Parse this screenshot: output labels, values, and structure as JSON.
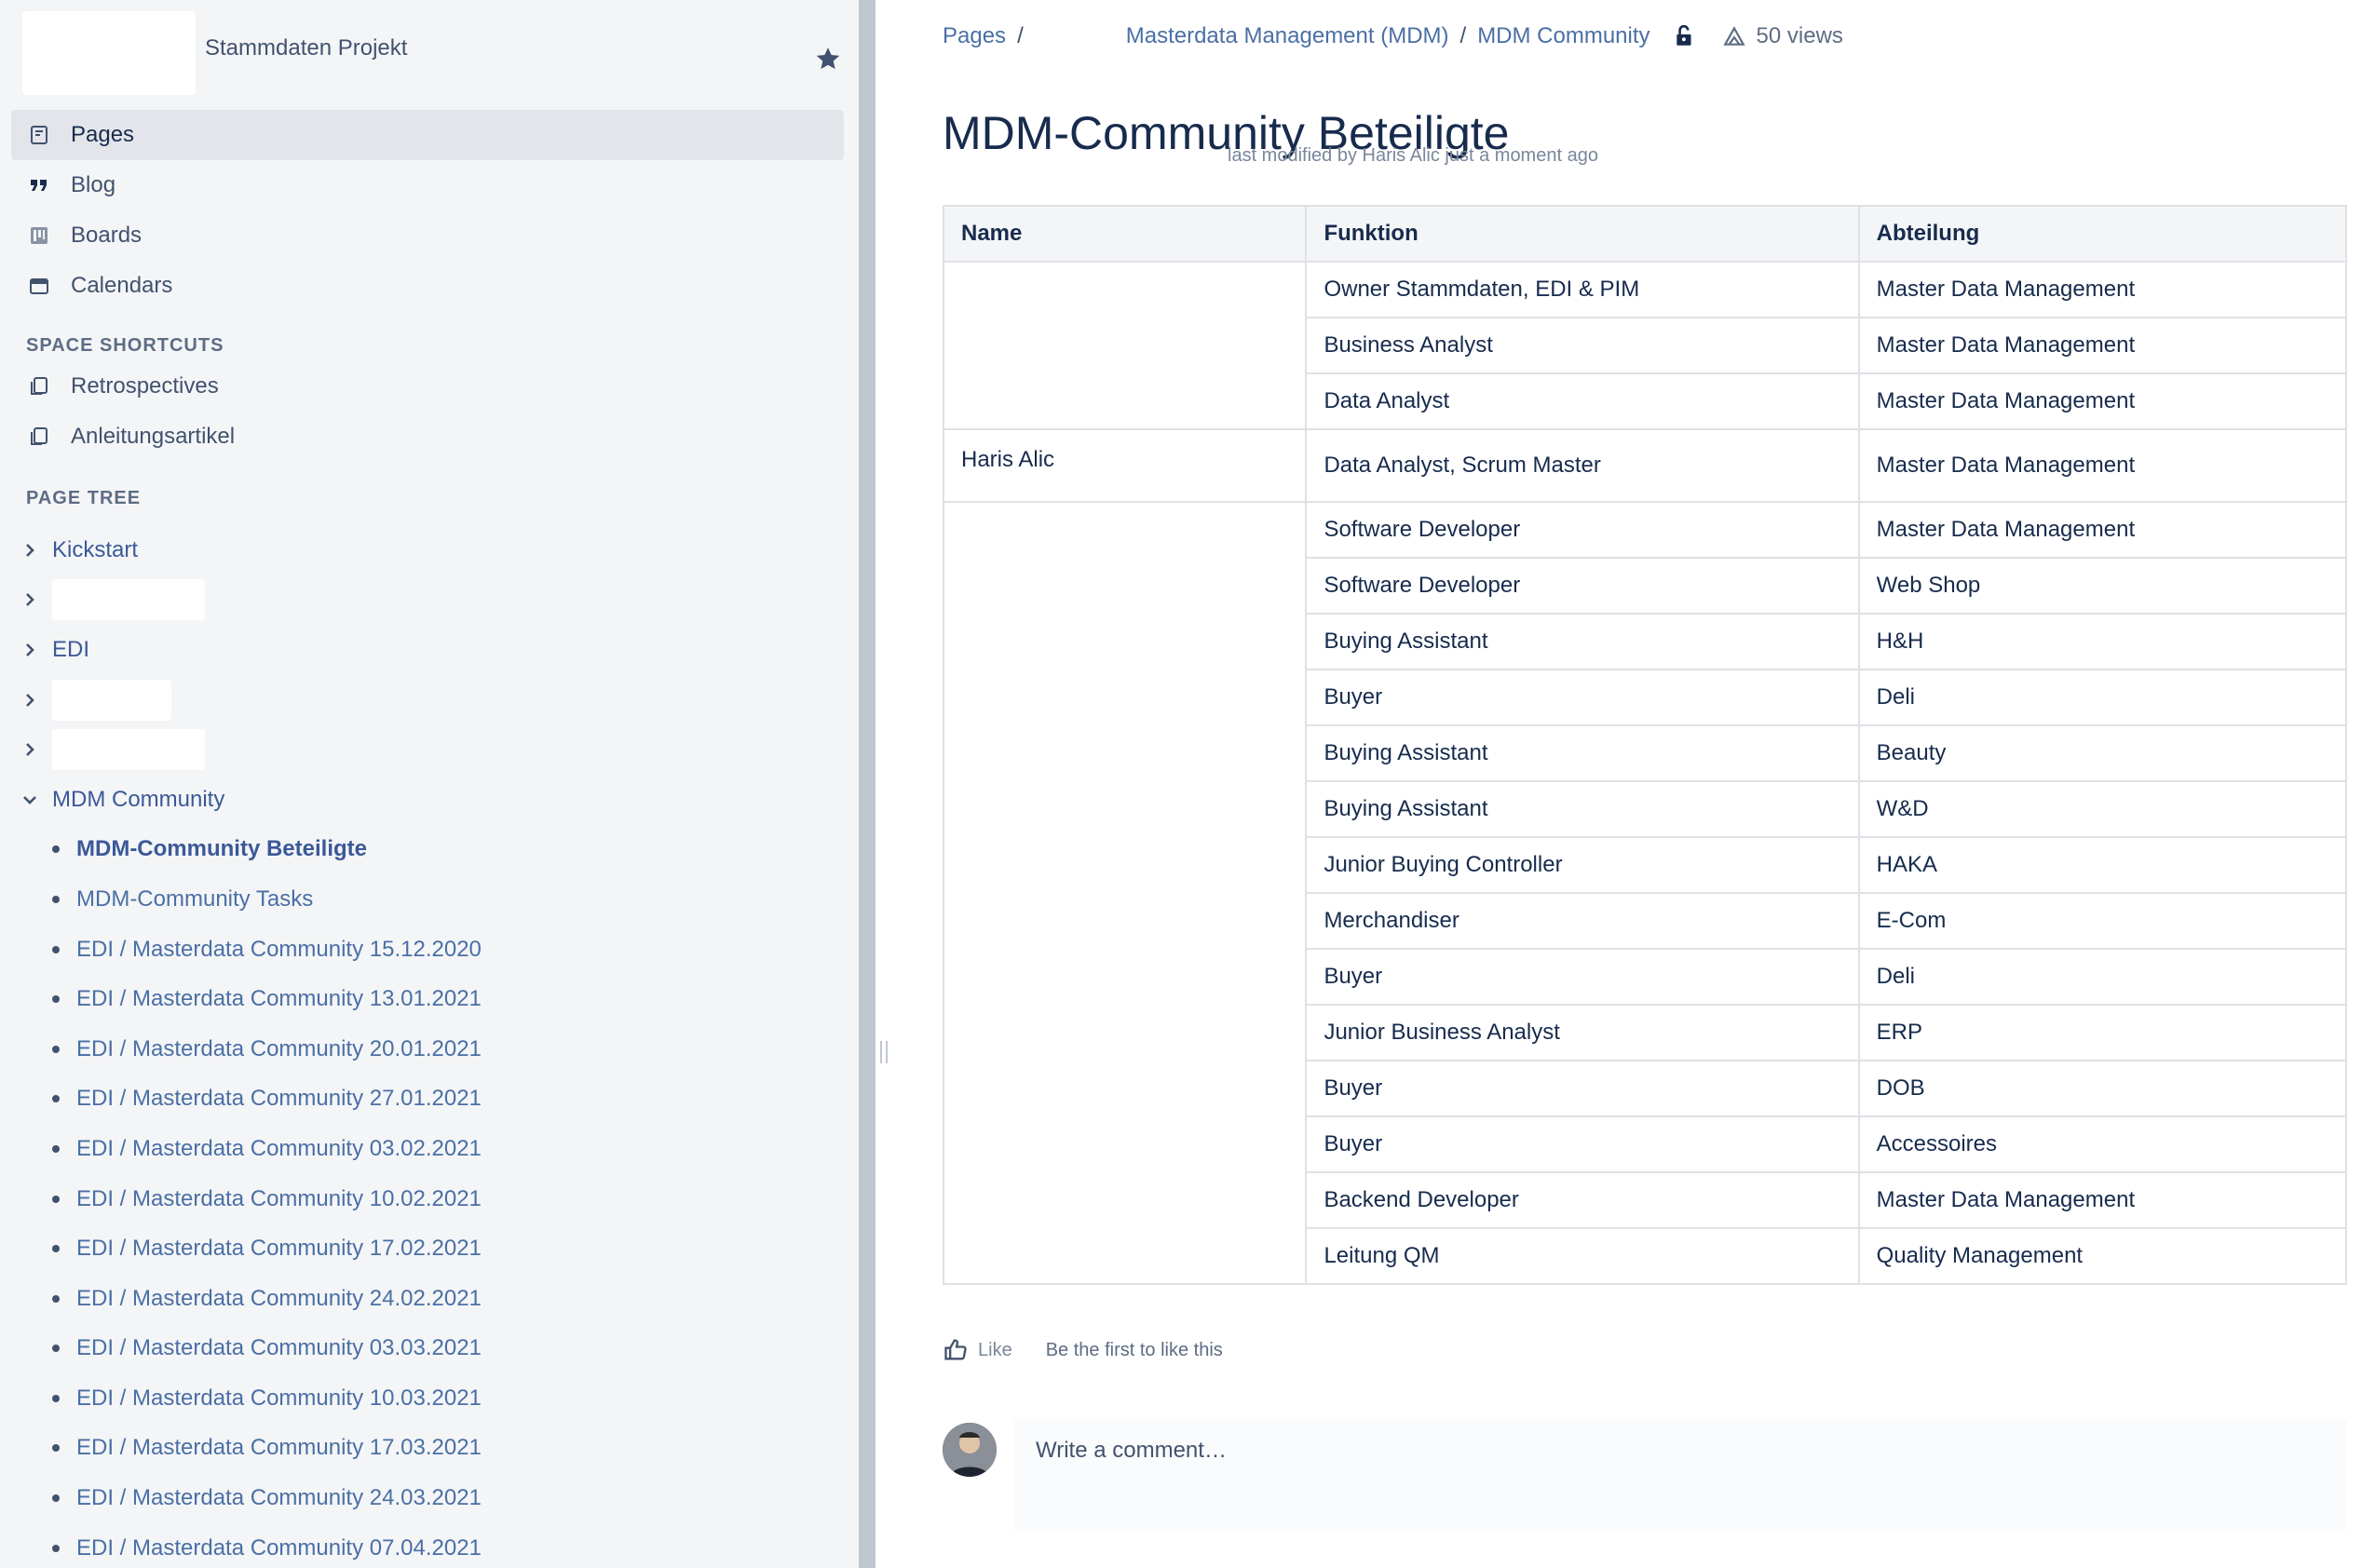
{
  "sidebar": {
    "space_title": "Stammdaten Projekt",
    "nav": [
      {
        "label": "Pages",
        "icon": "page-icon"
      },
      {
        "label": "Blog",
        "icon": "quote-icon"
      },
      {
        "label": "Boards",
        "icon": "board-icon"
      },
      {
        "label": "Calendars",
        "icon": "calendar-icon"
      }
    ],
    "shortcuts_heading": "SPACE SHORTCUTS",
    "shortcuts": [
      {
        "label": "Retrospectives",
        "icon": "copy-icon"
      },
      {
        "label": "Anleitungsartikel",
        "icon": "copy-icon"
      }
    ],
    "tree_heading": "PAGE TREE",
    "tree": [
      {
        "label": "Kickstart"
      },
      {
        "label": ""
      },
      {
        "label": "EDI"
      },
      {
        "label": ""
      },
      {
        "label": ""
      }
    ],
    "expanded_node": "MDM Community",
    "children": [
      "MDM-Community Beteiligte",
      "MDM-Community Tasks",
      "EDI / Masterdata Community 15.12.2020",
      "EDI / Masterdata Community 13.01.2021",
      "EDI / Masterdata Community 20.01.2021",
      "EDI / Masterdata Community 27.01.2021",
      "EDI / Masterdata Community 03.02.2021",
      "EDI / Masterdata Community 10.02.2021",
      "EDI / Masterdata Community 17.02.2021",
      "EDI / Masterdata Community 24.02.2021",
      "EDI / Masterdata Community 03.03.2021",
      "EDI / Masterdata Community 10.03.2021",
      "EDI / Masterdata Community 17.03.2021",
      "EDI / Masterdata Community 24.03.2021",
      "EDI / Masterdata Community 07.04.2021"
    ]
  },
  "breadcrumb": {
    "pages": "Pages",
    "crumb2": "Masterdata Management (MDM)",
    "crumb3": "MDM Community",
    "sep": "/",
    "views": "50 views"
  },
  "page": {
    "title": "MDM-Community Beteiligte",
    "byline": "last modified by Haris Alic just a moment ago"
  },
  "table": {
    "headers": [
      "Name",
      "Funktion",
      "Abteilung"
    ],
    "name_groups": [
      {
        "name": "",
        "rows": 3
      },
      {
        "name": "Haris Alic",
        "rows": 1
      },
      {
        "name": "",
        "rows": 14
      }
    ],
    "rows": [
      {
        "funktion": "Owner Stammdaten, EDI & PIM",
        "abteilung": "Master Data Management"
      },
      {
        "funktion": "Business Analyst",
        "abteilung": "Master Data Management"
      },
      {
        "funktion": "Data Analyst",
        "abteilung": "Master Data Management"
      },
      {
        "funktion": "Data Analyst, Scrum Master",
        "abteilung": "Master Data Management"
      },
      {
        "funktion": "Software Developer",
        "abteilung": "Master Data Management"
      },
      {
        "funktion": "Software Developer",
        "abteilung": "Web Shop"
      },
      {
        "funktion": "Buying Assistant",
        "abteilung": "H&H"
      },
      {
        "funktion": "Buyer",
        "abteilung": "Deli"
      },
      {
        "funktion": "Buying Assistant",
        "abteilung": "Beauty"
      },
      {
        "funktion": "Buying Assistant",
        "abteilung": "W&D"
      },
      {
        "funktion": "Junior Buying Controller",
        "abteilung": "HAKA"
      },
      {
        "funktion": "Merchandiser",
        "abteilung": "E-Com"
      },
      {
        "funktion": "Buyer",
        "abteilung": "Deli"
      },
      {
        "funktion": "Junior Business Analyst",
        "abteilung": "ERP"
      },
      {
        "funktion": "Buyer",
        "abteilung": "DOB"
      },
      {
        "funktion": "Buyer",
        "abteilung": "Accessoires"
      },
      {
        "funktion": "Backend Developer",
        "abteilung": "Master Data Management"
      },
      {
        "funktion": "Leitung QM",
        "abteilung": "Quality Management"
      }
    ]
  },
  "footer": {
    "like_label": "Like",
    "like_note": "Be the first to like this",
    "comment_placeholder": "Write a comment…"
  },
  "colors": {
    "sidebar_bg": "#f4f5f7",
    "link": "#4a6fa5",
    "text": "#172b4d",
    "divider": "#c1c7d0"
  }
}
